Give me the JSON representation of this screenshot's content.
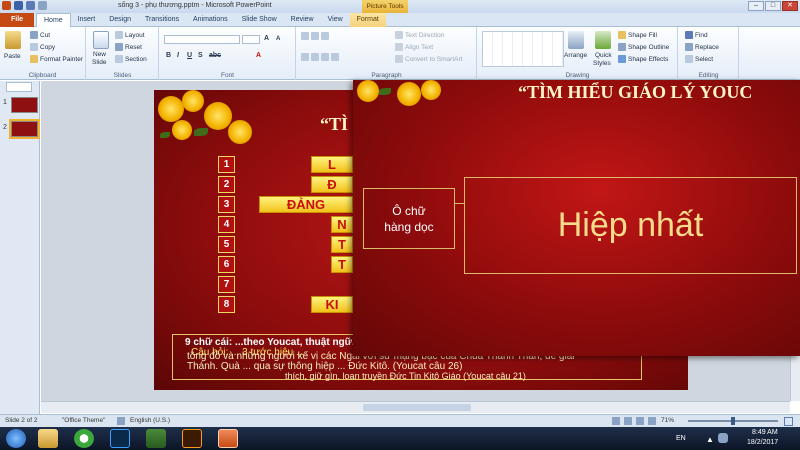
{
  "window": {
    "title": "sống 3 - phụ thương.pptm - Microsoft PowerPoint",
    "picture_tools": "Picture Tools",
    "buttons": [
      "–",
      "□",
      "✕"
    ]
  },
  "tabs": {
    "file": "File",
    "items": [
      "Home",
      "Insert",
      "Design",
      "Transitions",
      "Animations",
      "Slide Show",
      "Review",
      "View",
      "Format"
    ]
  },
  "ribbon": {
    "clipboard": {
      "paste": "Paste",
      "cut": "Cut",
      "copy": "Copy",
      "format_painter": "Format Painter",
      "label": "Clipboard"
    },
    "slides": {
      "new_slide": "New",
      "new_slide2": "Slide",
      "layout": "Layout",
      "reset": "Reset",
      "section": "Section",
      "label": "Slides"
    },
    "font": {
      "label": "Font"
    },
    "paragraph": {
      "text_direction": "Text Direction",
      "align_text": "Align Text",
      "convert": "Convert to SmartArt",
      "label": "Paragraph"
    },
    "drawing": {
      "arrange": "Arrange",
      "quick_styles": "Quick",
      "quick_styles2": "Styles",
      "shape_fill": "Shape Fill",
      "shape_outline": "Shape Outline",
      "shape_effects": "Shape Effects",
      "label": "Drawing"
    },
    "editing": {
      "find": "Find",
      "replace": "Replace",
      "select": "Select",
      "label": "Editing"
    }
  },
  "thumbnails": [
    {
      "num": "1"
    },
    {
      "num": "2"
    }
  ],
  "slide": {
    "title": "“TÌ",
    "numbers": [
      "1",
      "2",
      "3",
      "4",
      "5",
      "6",
      "7",
      "8"
    ],
    "answers": [
      "L",
      "Đ",
      "ĐẢNG",
      "N",
      "T",
      "T",
      "KI"
    ],
    "question_lines": [
      "9 chữ cái: ...theo Youcat, thuật ngữ...",
      "Câu hỏi: ... 3 tước hiệu ...",
      "tông đồ và những người kế vị các Ngài với sứ mạng bậc của Chúa Thánh Thần, để giải",
      "Thánh. Quà ... qua sự thông hiệp ... Đức Kitô. (Youcat câu 26)",
      "thích, giữ gìn, loan truyền Đức Tin Kitô Giáo (Youcat câu 21)"
    ]
  },
  "overlay": {
    "title": "“TÌM HIỂU GIÁO LÝ YOUC",
    "box_label_1": "Ô chữ",
    "box_label_2": "hàng dọc",
    "answer": "Hiệp nhất"
  },
  "status": {
    "slide": "Slide 2 of 2",
    "theme": "\"Office Theme\"",
    "language": "English (U.S.)",
    "zoom": "71%"
  },
  "taskbar": {
    "lang": "EN",
    "time": "8:49 AM",
    "date": "18/2/2017"
  },
  "colors": {
    "accent": "#c54a14",
    "slide_red": "#8c0c0c",
    "gold": "#f2c21a"
  }
}
